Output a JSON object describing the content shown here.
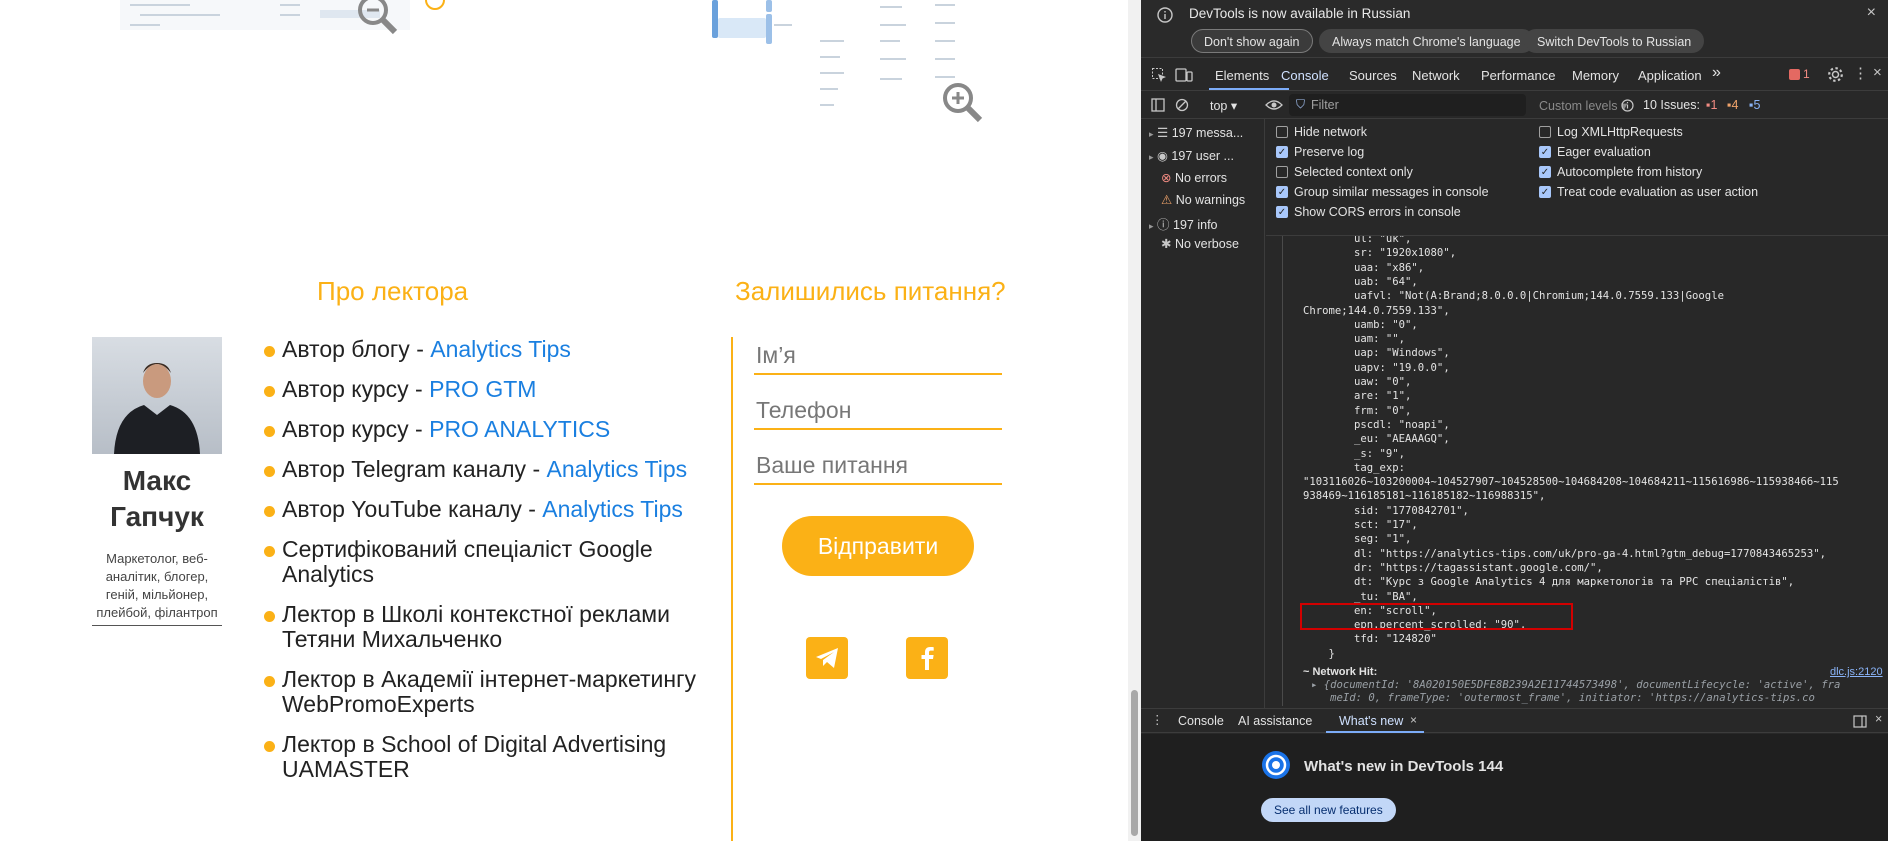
{
  "website": {
    "about_title": "Про лектора",
    "questions_title": "Залишились питання?",
    "lecturer_name": "Макс Гапчук",
    "lecturer_bio": "Маркетолог, веб-аналітик, блогер, геній, мільйонер, плейбой, філантроп",
    "list": [
      {
        "text": "Автор блогу - ",
        "link": "Analytics Tips"
      },
      {
        "text": "Автор курсу - ",
        "link": "PRO GTM"
      },
      {
        "text": "Автор курсу - ",
        "link": "PRO ANALYTICS"
      },
      {
        "text": "Автор Telegram каналу - ",
        "link": "Analytics Tips"
      },
      {
        "text": "Автор YouTube каналу - ",
        "link": "Analytics Tips"
      },
      {
        "text": "Сертифікований спеціаліст Google Analytics",
        "link": ""
      },
      {
        "text": "Лектор в Школі контекстної реклами Тетяни Михальченко",
        "link": ""
      },
      {
        "text": "Лектор в Академії інтернет-маркетингу WebPromoExperts",
        "link": ""
      },
      {
        "text": "Лектор в School of Digital Advertising UAMASTER",
        "link": ""
      }
    ],
    "form": {
      "name_placeholder": "Ім’я",
      "phone_placeholder": "Телефон",
      "question_placeholder": "Ваше питання",
      "submit_label": "Відправити"
    },
    "accent_color": "#fbb116",
    "link_color": "#1a7fe0"
  },
  "devtools": {
    "notice": {
      "message": "DevTools is now available in Russian",
      "btn_dont_show": "Don't show again",
      "btn_match": "Always match Chrome's language",
      "btn_switch": "Switch DevTools to Russian"
    },
    "tabs": [
      "Elements",
      "Console",
      "Sources",
      "Network",
      "Performance",
      "Memory",
      "Application"
    ],
    "active_tab": "Console",
    "error_count": "1",
    "toolbar": {
      "context": "top",
      "filter_placeholder": "Filter",
      "levels": "Custom levels",
      "issues_label": "10 Issues:",
      "issues_err": "1",
      "issues_warn": "4",
      "issues_info": "5"
    },
    "sidebar": [
      {
        "label": "197 messa...",
        "icon": "list-icon"
      },
      {
        "label": "197 user ...",
        "icon": "user-icon"
      },
      {
        "label": "No errors",
        "icon": "error-icon"
      },
      {
        "label": "No warnings",
        "icon": "warning-icon"
      },
      {
        "label": "197 info",
        "icon": "info-icon"
      },
      {
        "label": "No verbose",
        "icon": "bug-icon"
      }
    ],
    "settings_left": [
      {
        "label": "Hide network",
        "checked": false
      },
      {
        "label": "Preserve log",
        "checked": true
      },
      {
        "label": "Selected context only",
        "checked": false
      },
      {
        "label": "Group similar messages in console",
        "checked": true
      },
      {
        "label": "Show CORS errors in console",
        "checked": true
      }
    ],
    "settings_right": [
      {
        "label": "Log XMLHttpRequests",
        "checked": false
      },
      {
        "label": "Eager evaluation",
        "checked": true
      },
      {
        "label": "Autocomplete from history",
        "checked": true
      },
      {
        "label": "Treat code evaluation as user action",
        "checked": true
      }
    ],
    "console_lines": [
      "        ul: \"uk\",",
      "        sr: \"1920x1080\",",
      "        uaa: \"x86\",",
      "        uab: \"64\",",
      "        uafvl: \"Not(A:Brand;8.0.0.0|Chromium;144.0.7559.133|Google",
      "Chrome;144.0.7559.133\",",
      "        uamb: \"0\",",
      "        uam: \"\",",
      "        uap: \"Windows\",",
      "        uapv: \"19.0.0\",",
      "        uaw: \"0\",",
      "        are: \"1\",",
      "        frm: \"0\",",
      "        pscdl: \"noapi\",",
      "        _eu: \"AEAAAGQ\",",
      "        _s: \"9\",",
      "        tag_exp:",
      "\"103116026~103200004~104527907~104528500~104684208~104684211~115616986~115938466~115",
      "938469~116185181~116185182~116988315\",",
      "        sid: \"1770842701\",",
      "        sct: \"17\",",
      "        seg: \"1\",",
      "        dl: \"https://analytics-tips.com/uk/pro-ga-4.html?gtm_debug=1770843465253\",",
      "        dr: \"https://tagassistant.google.com/\",",
      "        dt: \"Курс з Google Analytics 4 для маркетологів та PPC спеціалістів\",",
      "        _tu: \"BA\",",
      "        en: \"scroll\",",
      "        epn.percent_scrolled: \"90\",",
      "        tfd: \"124820\"",
      "    }"
    ],
    "network_hit": {
      "label": "~ Network Hit:",
      "source": "dlc.js:2120",
      "detail1": "▸ {documentId: '8A020150E5DFE8B239A2E11744573498', documentLifecycle: 'active', fra",
      "detail2": "   meId: 0, frameType: 'outermost_frame', initiator: 'https://analytics-tips.co"
    },
    "drawer_tabs": [
      "Console",
      "AI assistance",
      "What's new"
    ],
    "whats_new": {
      "title": "What's new in DevTools 144",
      "button": "See all new features"
    }
  }
}
